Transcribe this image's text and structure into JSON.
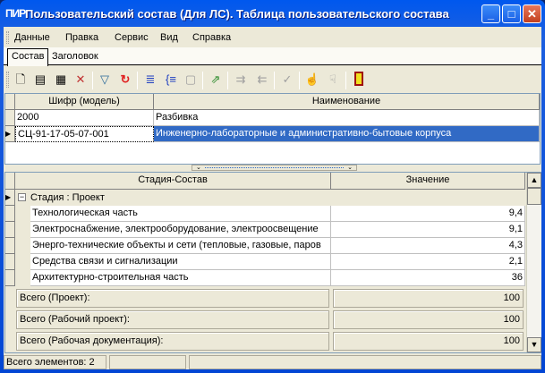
{
  "window": {
    "logo": "ПИР",
    "title": "Пользовательский состав (Для ЛС). Таблица пользовательского состава",
    "min": "_",
    "max": "□",
    "close": "✕"
  },
  "menu": [
    "Данные",
    "Правка",
    "Сервис",
    "Вид",
    "Справка"
  ],
  "tabs": [
    "Состав",
    "Заголовок"
  ],
  "toolbar": [
    "new-icon",
    "notepad-icon",
    "properties-icon",
    "delete-icon",
    "filter-icon",
    "refresh-icon",
    "import-icon",
    "bracket-icon",
    "copy-icon",
    "export-icon",
    "move-in-icon",
    "move-out-icon",
    "check-icon",
    "hand-up-icon",
    "hand-down-icon",
    "exit-door-icon"
  ],
  "top_grid": {
    "columns": [
      "Шифр (модель)",
      "Наименование"
    ],
    "rows": [
      [
        "2000",
        "Разбивка"
      ],
      [
        "СЦ-91-17-05-07-001",
        "Инженерно-лабораторные и административно-бытовые корпуса"
      ]
    ]
  },
  "bottom_grid": {
    "columns": [
      "Стадия-Состав",
      "Значение"
    ],
    "group": "Стадия : Проект",
    "group_toggle": "−",
    "rows": [
      [
        "Технологическая часть",
        "9,4"
      ],
      [
        "Электроснабжение, электрооборудование, электроосвещение",
        "9,1"
      ],
      [
        "Энерго-технические объекты и сети (тепловые, газовые, паров",
        "4,3"
      ],
      [
        "Средства связи и сигнализации",
        "2,1"
      ],
      [
        "Архитектурно-строительная часть",
        "36"
      ]
    ]
  },
  "totals": [
    [
      "Всего (Проект):",
      "100"
    ],
    [
      "Всего (Рабочий проект):",
      "100"
    ],
    [
      "Всего (Рабочая документация):",
      "100"
    ]
  ],
  "status": {
    "count": "Всего элементов: 2"
  },
  "colors": {
    "selection": "#316ac5",
    "title": "#0058ee"
  }
}
